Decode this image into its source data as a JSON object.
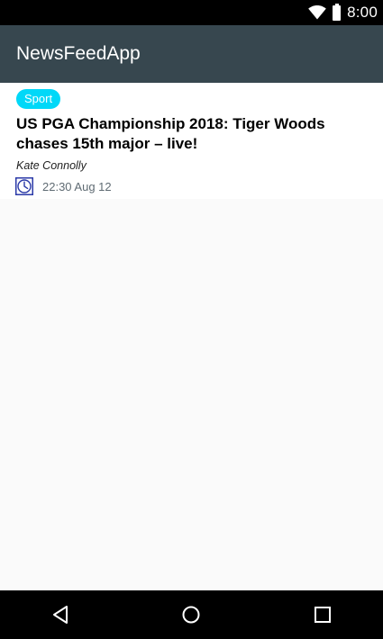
{
  "status_bar": {
    "time": "8:00",
    "icons": [
      "wifi-icon",
      "battery-icon"
    ]
  },
  "app_bar": {
    "title": "NewsFeedApp",
    "background": "#37474f"
  },
  "articles": [
    {
      "section": "Sport",
      "headline": "US PGA Championship 2018: Tiger Woods chases 15th major – live!",
      "author": "Kate Connolly",
      "timestamp": "22:30 Aug 12",
      "badge_color": "#00d8f8"
    }
  ],
  "nav_bar": {
    "buttons": [
      "back-icon",
      "home-icon",
      "recents-icon"
    ]
  }
}
